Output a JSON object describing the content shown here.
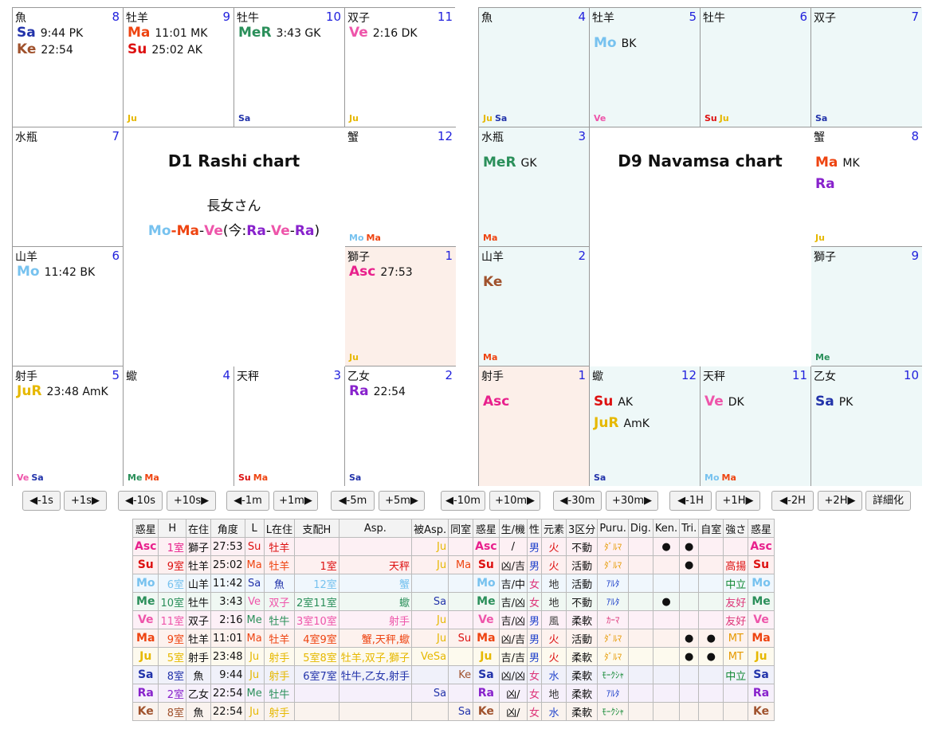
{
  "colors": {
    "Asc": "#e8208c",
    "Su": "#dd1111",
    "Mo": "#77c2ef",
    "Me": "#2a8f5a",
    "Ve": "#ee55aa",
    "Ma": "#ee4411",
    "Ju": "#e6b800",
    "Sa": "#2233aa",
    "Ra": "#8822cc",
    "Ke": "#a0522d"
  },
  "d1": {
    "title": "D1 Rashi chart",
    "subtitle": "長女さん",
    "dasha": [
      {
        "p": "Mo",
        "t": "Mo"
      },
      {
        "p": "Ma",
        "t": "-"
      },
      {
        "p": "Ma",
        "t": "Ma"
      },
      {
        "p": null,
        "t": "-"
      },
      {
        "p": "Ve",
        "t": "Ve"
      },
      {
        "p": null,
        "t": "(今:"
      },
      {
        "p": "Ra",
        "t": "Ra"
      },
      {
        "p": null,
        "t": "-"
      },
      {
        "p": "Ve",
        "t": "Ve"
      },
      {
        "p": null,
        "t": "-"
      },
      {
        "p": "Ra",
        "t": "Ra"
      },
      {
        "p": null,
        "t": ")"
      }
    ],
    "cells": [
      {
        "sign": "魚",
        "num": "8",
        "planets": [
          {
            "p": "Sa",
            "t": "9:44 PK"
          },
          {
            "p": "Ke",
            "t": "22:54"
          }
        ],
        "foot": []
      },
      {
        "sign": "牡羊",
        "num": "9",
        "planets": [
          {
            "p": "Ma",
            "t": "11:01 MK"
          },
          {
            "p": "Su",
            "t": "25:02 AK"
          }
        ],
        "foot": [
          "Ju"
        ]
      },
      {
        "sign": "牡牛",
        "num": "10",
        "planets": [
          {
            "p": "Me",
            "label": "MeR",
            "t": "3:43 GK"
          }
        ],
        "foot": [
          "Sa"
        ]
      },
      {
        "sign": "双子",
        "num": "11",
        "planets": [
          {
            "p": "Ve",
            "t": "2:16 DK"
          }
        ],
        "foot": [
          "Ju"
        ]
      },
      {
        "sign": "水瓶",
        "num": "7",
        "planets": [],
        "foot": []
      },
      {
        "sign": "蟹",
        "num": "12",
        "planets": [],
        "foot": [
          "Mo",
          "Ma"
        ]
      },
      {
        "sign": "山羊",
        "num": "6",
        "planets": [
          {
            "p": "Mo",
            "t": "11:42 BK"
          }
        ],
        "foot": []
      },
      {
        "sign": "獅子",
        "num": "1",
        "planets": [
          {
            "p": "Asc",
            "t": "27:53"
          }
        ],
        "foot": [
          "Ju"
        ]
      },
      {
        "sign": "射手",
        "num": "5",
        "planets": [
          {
            "p": "Ju",
            "label": "JuR",
            "t": "23:48 AmK"
          }
        ],
        "foot": [
          "Ve",
          "Sa"
        ]
      },
      {
        "sign": "蠍",
        "num": "4",
        "planets": [],
        "foot": [
          "Me",
          "Ma"
        ]
      },
      {
        "sign": "天秤",
        "num": "3",
        "planets": [],
        "foot": [
          "Su",
          "Ma"
        ]
      },
      {
        "sign": "乙女",
        "num": "2",
        "planets": [
          {
            "p": "Ra",
            "t": "22:54"
          }
        ],
        "foot": [
          "Sa"
        ]
      }
    ]
  },
  "d9": {
    "title": "D9 Navamsa chart",
    "cells": [
      {
        "sign": "魚",
        "num": "4",
        "planets": [],
        "foot": [
          "Ju",
          "Sa"
        ]
      },
      {
        "sign": "牡羊",
        "num": "5",
        "planets": [
          {
            "p": "Mo",
            "t": "BK"
          }
        ],
        "foot": [
          "Ve"
        ]
      },
      {
        "sign": "牡牛",
        "num": "6",
        "planets": [],
        "foot": [
          "Su",
          "Ju"
        ]
      },
      {
        "sign": "双子",
        "num": "7",
        "planets": [],
        "foot": [
          "Sa"
        ]
      },
      {
        "sign": "水瓶",
        "num": "3",
        "planets": [
          {
            "p": "Me",
            "label": "MeR",
            "t": "GK"
          }
        ],
        "foot": [
          "Ma"
        ]
      },
      {
        "sign": "蟹",
        "num": "8",
        "planets": [
          {
            "p": "Ma",
            "t": "MK"
          },
          {
            "p": "Ra",
            "t": ""
          }
        ],
        "foot": [
          "Ju"
        ]
      },
      {
        "sign": "山羊",
        "num": "2",
        "planets": [
          {
            "p": "Ke",
            "t": ""
          }
        ],
        "foot": [
          "Ma"
        ]
      },
      {
        "sign": "獅子",
        "num": "9",
        "planets": [],
        "foot": [
          "Me"
        ]
      },
      {
        "sign": "射手",
        "num": "1",
        "planets": [
          {
            "p": "Asc",
            "t": ""
          }
        ],
        "foot": []
      },
      {
        "sign": "蠍",
        "num": "12",
        "planets": [
          {
            "p": "Su",
            "t": "AK"
          },
          {
            "p": "Ju",
            "label": "JuR",
            "t": "AmK"
          }
        ],
        "foot": [
          "Sa"
        ]
      },
      {
        "sign": "天秤",
        "num": "11",
        "planets": [
          {
            "p": "Ve",
            "t": "DK"
          }
        ],
        "foot": [
          "Mo",
          "Ma"
        ]
      },
      {
        "sign": "乙女",
        "num": "10",
        "planets": [
          {
            "p": "Sa",
            "t": "PK"
          }
        ],
        "foot": []
      }
    ]
  },
  "buttons": [
    "◀-1s",
    "+1s▶",
    "◀-10s",
    "+10s▶",
    "◀-1m",
    "+1m▶",
    "◀-5m",
    "+5m▶",
    "◀-10m",
    "+10m▶",
    "◀-30m",
    "+30m▶",
    "◀-1H",
    "+1H▶",
    "◀-2H",
    "+2H▶",
    "詳細化"
  ],
  "table": {
    "headers": [
      "惑星",
      "H",
      "在住",
      "角度",
      "L",
      "L在住",
      "支配H",
      "Asp.",
      "被Asp.",
      "同室",
      "惑星",
      "生/機",
      "性",
      "元素",
      "3区分",
      "Puru.",
      "Dig.",
      "Ken.",
      "Tri.",
      "自室",
      "強さ",
      "惑星"
    ],
    "rows": [
      {
        "p": "Asc",
        "h": "1室",
        "sign": "獅子",
        "deg": "27:53",
        "l": "Su",
        "lsign": "牡羊",
        "rule": "",
        "asp": "",
        "asped": "Ju",
        "same": "",
        "nat": "/",
        "sex": "男",
        "elem": "火",
        "mode": "不動",
        "puru": "ﾀﾞﾙﾏ",
        "dig": "",
        "ken": "●",
        "tri": "●",
        "own": "",
        "str": ""
      },
      {
        "p": "Su",
        "h": "9室",
        "sign": "牡羊",
        "deg": "25:02",
        "l": "Ma",
        "lsign": "牡羊",
        "rule": "1室",
        "asp": "天秤",
        "asped": "Ju",
        "same": "Ma",
        "nat": "凶/吉",
        "sex": "男",
        "elem": "火",
        "mode": "活動",
        "puru": "ﾀﾞﾙﾏ",
        "dig": "",
        "ken": "",
        "tri": "●",
        "own": "",
        "str": "高揚"
      },
      {
        "p": "Mo",
        "h": "6室",
        "sign": "山羊",
        "deg": "11:42",
        "l": "Sa",
        "lsign": "魚",
        "rule": "12室",
        "asp": "蟹",
        "asped": "",
        "same": "",
        "nat": "吉/中",
        "sex": "女",
        "elem": "地",
        "mode": "活動",
        "puru": "ｱﾙﾀ",
        "dig": "",
        "ken": "",
        "tri": "",
        "own": "",
        "str": "中立"
      },
      {
        "p": "Me",
        "h": "10室",
        "sign": "牡牛",
        "deg": "3:43",
        "l": "Ve",
        "lsign": "双子",
        "rule": "2室11室",
        "asp": "蠍",
        "asped": "Sa",
        "same": "",
        "nat": "吉/凶",
        "sex": "女",
        "elem": "地",
        "mode": "不動",
        "puru": "ｱﾙﾀ",
        "dig": "",
        "ken": "●",
        "tri": "",
        "own": "",
        "str": "友好"
      },
      {
        "p": "Ve",
        "h": "11室",
        "sign": "双子",
        "deg": "2:16",
        "l": "Me",
        "lsign": "牡牛",
        "rule": "3室10室",
        "asp": "射手",
        "asped": "Ju",
        "same": "",
        "nat": "吉/凶",
        "sex": "男",
        "elem": "風",
        "mode": "柔軟",
        "puru": "ｶｰﾏ",
        "dig": "",
        "ken": "",
        "tri": "",
        "own": "",
        "str": "友好"
      },
      {
        "p": "Ma",
        "h": "9室",
        "sign": "牡羊",
        "deg": "11:01",
        "l": "Ma",
        "lsign": "牡羊",
        "rule": "4室9室",
        "asp": "蟹,天秤,蠍",
        "asped": "Ju",
        "same": "Su",
        "nat": "凶/吉",
        "sex": "男",
        "elem": "火",
        "mode": "活動",
        "puru": "ﾀﾞﾙﾏ",
        "dig": "",
        "ken": "",
        "tri": "●",
        "own": "●",
        "str": "MT"
      },
      {
        "p": "Ju",
        "h": "5室",
        "sign": "射手",
        "deg": "23:48",
        "l": "Ju",
        "lsign": "射手",
        "rule": "5室8室",
        "asp": "牡羊,双子,獅子",
        "asped": "VeSa",
        "same": "",
        "nat": "吉/吉",
        "sex": "男",
        "elem": "火",
        "mode": "柔軟",
        "puru": "ﾀﾞﾙﾏ",
        "dig": "",
        "ken": "",
        "tri": "●",
        "own": "●",
        "str": "MT"
      },
      {
        "p": "Sa",
        "h": "8室",
        "sign": "魚",
        "deg": "9:44",
        "l": "Ju",
        "lsign": "射手",
        "rule": "6室7室",
        "asp": "牡牛,乙女,射手",
        "asped": "",
        "same": "Ke",
        "nat": "凶/凶",
        "sex": "女",
        "elem": "水",
        "mode": "柔軟",
        "puru": "ﾓｰｸｼｬ",
        "dig": "",
        "ken": "",
        "tri": "",
        "own": "",
        "str": "中立"
      },
      {
        "p": "Ra",
        "h": "2室",
        "sign": "乙女",
        "deg": "22:54",
        "l": "Me",
        "lsign": "牡牛",
        "rule": "",
        "asp": "",
        "asped": "Sa",
        "same": "",
        "nat": "凶/",
        "sex": "女",
        "elem": "地",
        "mode": "柔軟",
        "puru": "ｱﾙﾀ",
        "dig": "",
        "ken": "",
        "tri": "",
        "own": "",
        "str": ""
      },
      {
        "p": "Ke",
        "h": "8室",
        "sign": "魚",
        "deg": "22:54",
        "l": "Ju",
        "lsign": "射手",
        "rule": "",
        "asp": "",
        "asped": "",
        "same": "Sa",
        "nat": "凶/",
        "sex": "女",
        "elem": "水",
        "mode": "柔軟",
        "puru": "ﾓｰｸｼｬ",
        "dig": "",
        "ken": "",
        "tri": "",
        "own": "",
        "str": ""
      }
    ]
  }
}
